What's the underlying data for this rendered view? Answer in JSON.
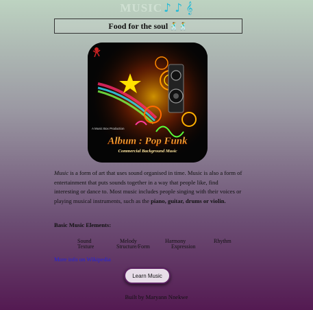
{
  "header": {
    "title": "MUSIC",
    "notes": "♪ ♪ 𝄞"
  },
  "tagline": {
    "text": "Food for the soul",
    "icon": "dancers-icon"
  },
  "album": {
    "line1": "A Music Box Production",
    "title": "Album : Pop Funk",
    "subtitle": "Commercial Background Music"
  },
  "description": {
    "term": "Music",
    "part1": " is a form of art that uses sound organised in time. Music is also a form of entertainment that puts sounds together in a way that people like, find interesting or dance to. Most music includes people singing with their voices or playing musical instruments, such as the ",
    "bold": "piano, guitar, drums or violin.",
    "end": ""
  },
  "elements": {
    "heading": "Basic Music Elements:",
    "items": [
      "Sound",
      "Melody",
      "Harmony",
      "Rhythm",
      "Texture",
      "Structure/Form",
      "Expression"
    ]
  },
  "links": {
    "more_info": "More info on Wikipedia"
  },
  "buttons": {
    "learn": "Learn Music"
  },
  "footer": {
    "text": "Built by Maryann Nnekwe"
  },
  "colors": {
    "note": "#1fb9d6",
    "link": "#2222dd",
    "button_border": "#5a2060"
  }
}
